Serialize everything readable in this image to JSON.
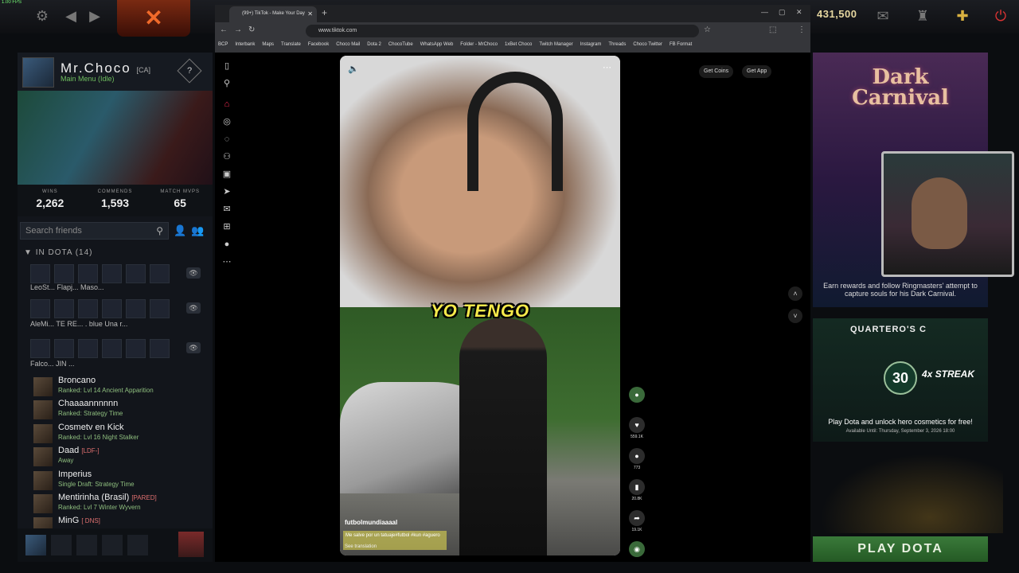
{
  "topbar": {
    "fps": "1.00 FPS",
    "gold": "431,500"
  },
  "profile": {
    "name": "Mr.Choco",
    "tag": "[CA]",
    "status": "Main Menu (Idle)"
  },
  "stats": [
    {
      "label": "WINS",
      "value": "2,262"
    },
    {
      "label": "COMMENDS",
      "value": "1,593"
    },
    {
      "label": "MATCH MVPS",
      "value": "65"
    }
  ],
  "friends_search": {
    "placeholder": "Search friends"
  },
  "in_dota": {
    "label": "IN DOTA (14)"
  },
  "parties": [
    {
      "names": "LeoSt...  Flapj...  Maso..."
    },
    {
      "names": "AleMi...  TE RE...    .       blue   Una r..."
    },
    {
      "names": "Falco...   JIN ..."
    }
  ],
  "friends": [
    {
      "name": "Broncano",
      "tag": "",
      "status": "Ranked: Lvl 14 Ancient Apparition"
    },
    {
      "name": "Chaaaannnnnn",
      "tag": "",
      "status": "Ranked: Strategy Time"
    },
    {
      "name": "Cosmetv en Kick",
      "tag": "",
      "status": "Ranked: Lvl 16 Night Stalker"
    },
    {
      "name": "Daad",
      "tag": "[LDF-]",
      "status": "Away"
    },
    {
      "name": "Imperius",
      "tag": "",
      "status": "Single Draft: Strategy Time"
    },
    {
      "name": "Mentirinha (Brasil)",
      "tag": "[PARED]",
      "status": "Ranked: Lvl 7 Winter Wyvern"
    },
    {
      "name": "MinG",
      "tag": "[ DNS]",
      "status": ""
    }
  ],
  "browser": {
    "tab_title": "(99+) TikTok - Make Your Day",
    "url": "www.tiktok.com",
    "bookmarks": [
      "BCP",
      "Interbank",
      "Maps",
      "Translate",
      "Facebook",
      "Choco Mail",
      "Dota 2",
      "ChocoTube",
      "WhatsApp Web",
      "Folder - MrChoco",
      "1xBet Choco",
      "Twitch Manager",
      "Instagram",
      "Threads",
      "Choco Twitter",
      "FB Format"
    ]
  },
  "tiktok": {
    "get_coins": "Get Coins",
    "get_app": "Get App",
    "caption": "YO TENGO",
    "username": "futbolmundiaaaal",
    "description": "Me salve por un tatuaje#futbol #kun #aguero",
    "see_translation": "See translation",
    "likes": "559.1K",
    "comments": "773",
    "saves": "20.8K",
    "shares": "19.1K"
  },
  "dark_carnival": {
    "title": "Dark Carnival",
    "text": "Earn rewards and follow Ringmasters' attempt to capture souls for his Dark Carnival."
  },
  "quartero": {
    "title": "QUARTERO'S C",
    "streak_num": "30",
    "streak": "4x STREAK",
    "text": "Play Dota and unlock hero cosmetics for free!",
    "date": "Available Until: Thursday, September 3, 2026 18:00"
  },
  "play_button": "PLAY DOTA",
  "colors": {
    "play": "#2f6e2f",
    "status_green": "#6fbf5f",
    "caption_yellow": "#f5e94a"
  }
}
